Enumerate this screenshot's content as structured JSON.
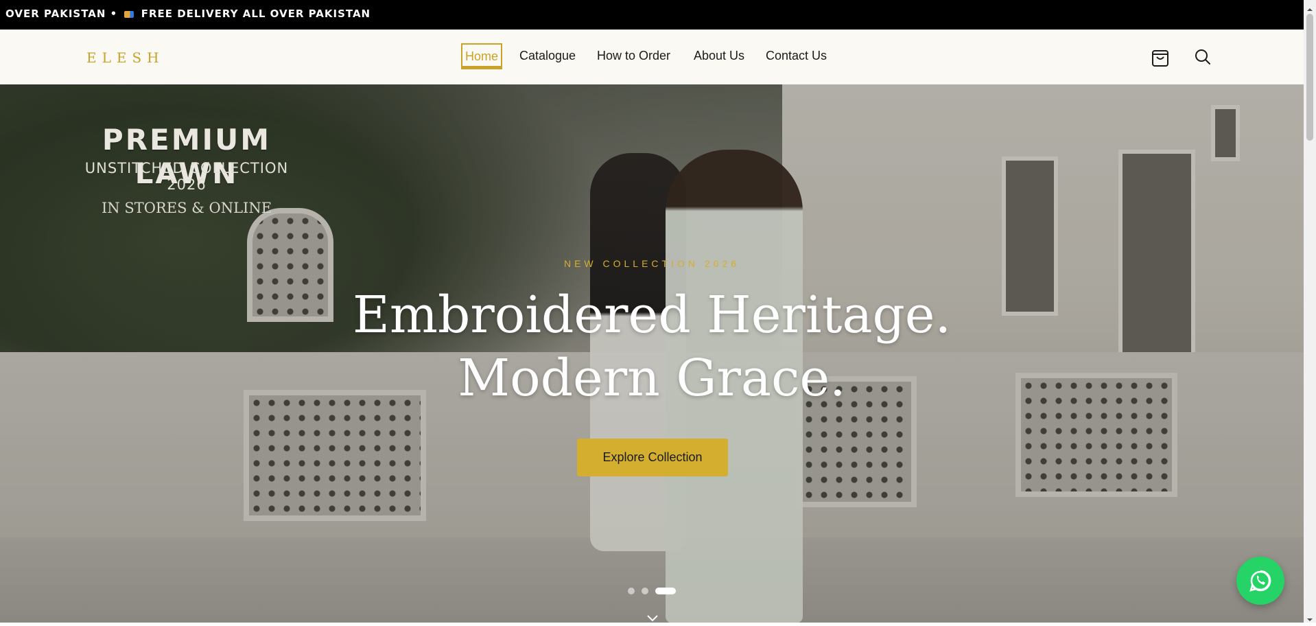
{
  "announcement": {
    "text": "OVER PAKISTAN • ",
    "text2": " FREE DELIVERY ALL OVER PAKISTAN"
  },
  "header": {
    "logo": "ELESH",
    "nav": [
      {
        "label": "Home",
        "active": true
      },
      {
        "label": "Catalogue",
        "active": false
      },
      {
        "label": "How to Order",
        "active": false
      },
      {
        "label": "About Us",
        "active": false
      },
      {
        "label": "Contact Us",
        "active": false
      }
    ],
    "icons": [
      "cart-icon",
      "search-icon"
    ]
  },
  "hero": {
    "promo_title": "PREMIUM LAWN",
    "promo_subtitle": "UNSTITCHED COLLECTION 2026",
    "promo_tagline": "IN STORES & ONLINE",
    "kicker": "NEW COLLECTION 2026",
    "headline_line1": "Embroidered Heritage.",
    "headline_line2": "Modern Grace.",
    "cta_label": "Explore Collection",
    "slides_total": 3,
    "active_slide": 3
  },
  "colors": {
    "accent": "#d4ae2f",
    "header_bg": "#faf9f3",
    "announcement_bg": "#000000",
    "whatsapp": "#25d366"
  }
}
